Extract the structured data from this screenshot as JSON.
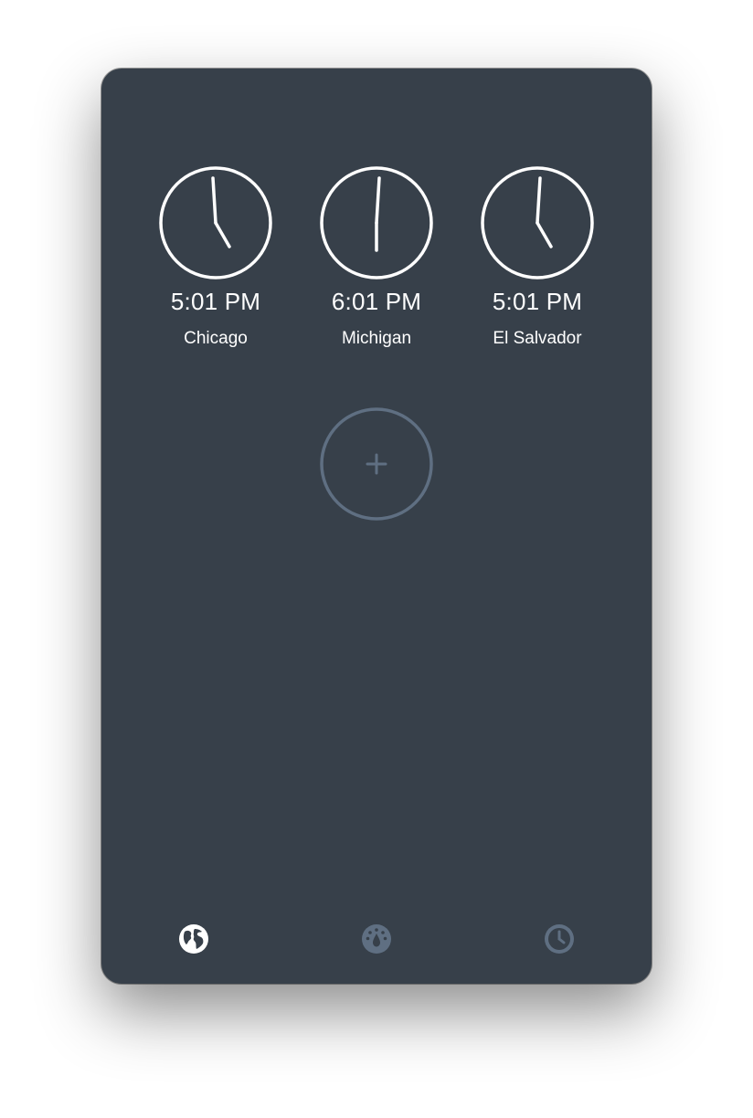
{
  "colors": {
    "background": "#37404a",
    "clock_stroke": "#ffffff",
    "muted": "#5f6f82",
    "text": "#ffffff"
  },
  "clocks": [
    {
      "time": "5:01 PM",
      "city": "Chicago"
    },
    {
      "time": "6:01 PM",
      "city": "Michigan"
    },
    {
      "time": "5:01 PM",
      "city": "El Salvador"
    }
  ],
  "add_button": {
    "label": "+",
    "icon": "plus-icon"
  },
  "tabs": [
    {
      "icon": "globe-icon",
      "active": true
    },
    {
      "icon": "water-drop-gauge-icon",
      "active": false
    },
    {
      "icon": "clock-icon",
      "active": false
    }
  ]
}
